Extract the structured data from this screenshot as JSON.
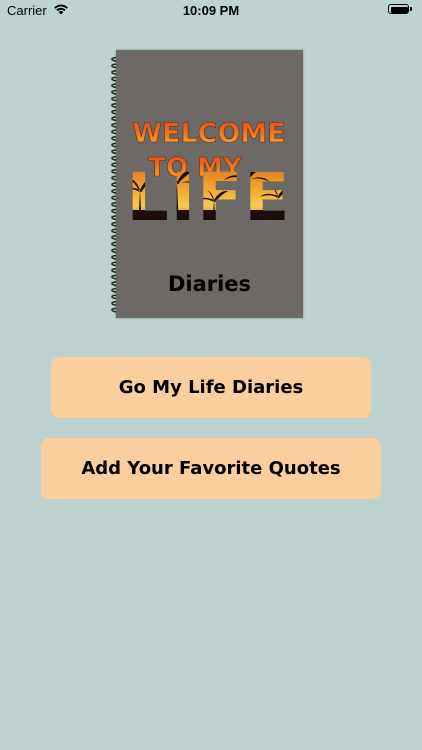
{
  "status_bar": {
    "carrier": "Carrier",
    "time": "10:09 PM",
    "battery_level": 1.0
  },
  "cover": {
    "line1": "WELCOME",
    "line2": "TO MY",
    "line3": "LIFE",
    "label": "Diaries"
  },
  "buttons": {
    "diaries": "Go My Life Diaries",
    "quotes": "Add Your Favorite Quotes"
  },
  "colors": {
    "background": "#bed3d0",
    "button": "#fbcf9d",
    "cover": "#6d6966",
    "title_orange": "#e65a1c",
    "title_yellow": "#f5b62e"
  }
}
